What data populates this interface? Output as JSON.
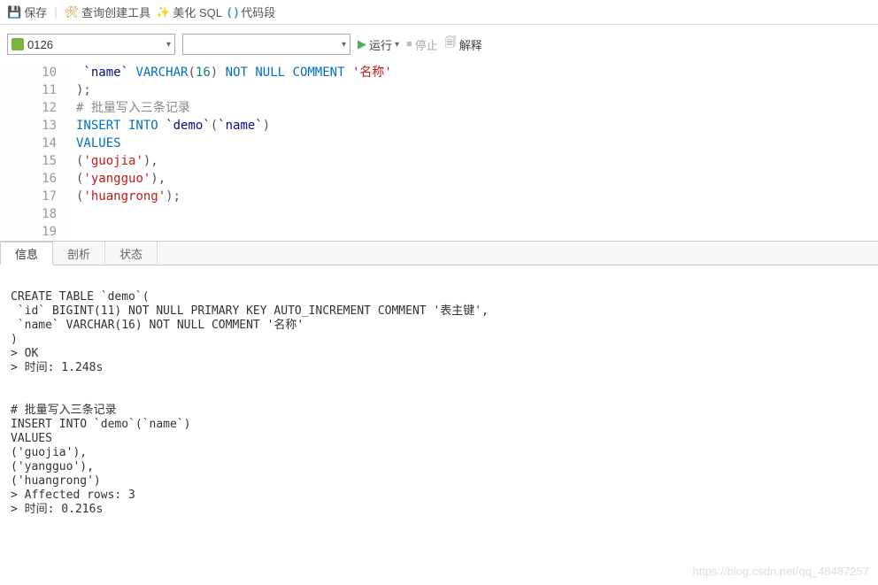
{
  "toolbar": {
    "save": "保存",
    "queryTools": "查询创建工具",
    "beautify": "美化 SQL",
    "snippet": "代码段"
  },
  "controls": {
    "dbName": "0126",
    "otherSelect": "",
    "run": "运行",
    "stop": "停止",
    "explain": "解释"
  },
  "editor": {
    "lines": [
      {
        "num": "10",
        "tokens": [
          {
            "t": " ",
            "c": ""
          },
          {
            "t": "`name`",
            "c": "ident"
          },
          {
            "t": " ",
            "c": ""
          },
          {
            "t": "VARCHAR",
            "c": "type"
          },
          {
            "t": "(",
            "c": "paren"
          },
          {
            "t": "16",
            "c": "num"
          },
          {
            "t": ")",
            "c": "paren"
          },
          {
            "t": " ",
            "c": ""
          },
          {
            "t": "NOT NULL",
            "c": "kw"
          },
          {
            "t": " ",
            "c": ""
          },
          {
            "t": "COMMENT",
            "c": "kw"
          },
          {
            "t": " ",
            "c": ""
          },
          {
            "t": "'名称'",
            "c": "str"
          }
        ]
      },
      {
        "num": "11",
        "tokens": [
          {
            "t": ");",
            "c": "paren"
          }
        ]
      },
      {
        "num": "12",
        "tokens": [
          {
            "t": "# 批量写入三条记录",
            "c": "cmt"
          }
        ]
      },
      {
        "num": "13",
        "tokens": [
          {
            "t": "INSERT INTO",
            "c": "kw"
          },
          {
            "t": " ",
            "c": ""
          },
          {
            "t": "`demo`",
            "c": "ident"
          },
          {
            "t": "(",
            "c": "paren"
          },
          {
            "t": "`name`",
            "c": "ident"
          },
          {
            "t": ")",
            "c": "paren"
          }
        ]
      },
      {
        "num": "14",
        "tokens": [
          {
            "t": "VALUES",
            "c": "kw"
          }
        ]
      },
      {
        "num": "15",
        "tokens": [
          {
            "t": "(",
            "c": "paren"
          },
          {
            "t": "'guojia'",
            "c": "str"
          },
          {
            "t": "),",
            "c": "paren"
          }
        ]
      },
      {
        "num": "16",
        "tokens": [
          {
            "t": "(",
            "c": "paren"
          },
          {
            "t": "'yangguo'",
            "c": "str"
          },
          {
            "t": "),",
            "c": "paren"
          }
        ]
      },
      {
        "num": "17",
        "tokens": [
          {
            "t": "(",
            "c": "paren"
          },
          {
            "t": "'huangrong'",
            "c": "str"
          },
          {
            "t": ");",
            "c": "paren"
          }
        ]
      },
      {
        "num": "18",
        "tokens": []
      },
      {
        "num": "19",
        "tokens": []
      }
    ]
  },
  "tabs": {
    "info": "信息",
    "profile": "剖析",
    "status": "状态"
  },
  "messages": "\nCREATE TABLE `demo`(\n `id` BIGINT(11) NOT NULL PRIMARY KEY AUTO_INCREMENT COMMENT '表主键',\n `name` VARCHAR(16) NOT NULL COMMENT '名称'\n)\n> OK\n> 时间: 1.248s\n\n\n# 批量写入三条记录\nINSERT INTO `demo`(`name`)\nVALUES\n('guojia'),\n('yangguo'),\n('huangrong')\n> Affected rows: 3\n> 时间: 0.216s\n",
  "watermark": "https://blog.csdn.net/qq_48487257"
}
